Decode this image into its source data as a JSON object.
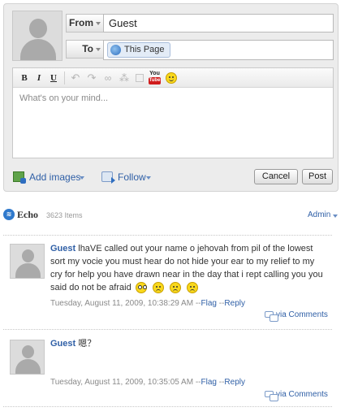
{
  "compose": {
    "from_label": "From",
    "from_value": "Guest",
    "to_label": "To",
    "to_value": "This Page",
    "toolbar": {
      "bold": "B",
      "italic": "I",
      "underline": "U",
      "undo": "↶",
      "redo": "↷",
      "link": "∞",
      "unlink": "⁂",
      "youtube_top": "You",
      "youtube_bottom": "Tube"
    },
    "placeholder": "What's on your mind...",
    "add_images": "Add images",
    "follow": "Follow",
    "cancel": "Cancel",
    "post": "Post"
  },
  "echo": {
    "logo": "≋",
    "title": "Echo",
    "count": "3623 Items",
    "admin": "Admin"
  },
  "comments": [
    {
      "author": "Guest",
      "text": "lhaVE called out your name o jehovah from pil of the lowest sort my vocie you must hear do not hide your ear to my relief to my cry for help you have drawn near in the day that i rept calling you you said do not be afraid",
      "timestamp": "Tuesday, August 11, 2009, 10:38:29 AM",
      "sep1": "--",
      "flag": "Flag",
      "sep2": "--",
      "reply": "Reply",
      "via": "via Comments"
    },
    {
      "author": "Guest",
      "text": "嗯？",
      "timestamp": "Tuesday, August 11, 2009, 10:35:05 AM",
      "sep1": "--",
      "flag": "Flag",
      "sep2": "--",
      "reply": "Reply",
      "via": "via Comments"
    }
  ],
  "colors": {
    "link": "#2f5fa6",
    "panel": "#ececec",
    "meta": "#8a8a8a"
  }
}
